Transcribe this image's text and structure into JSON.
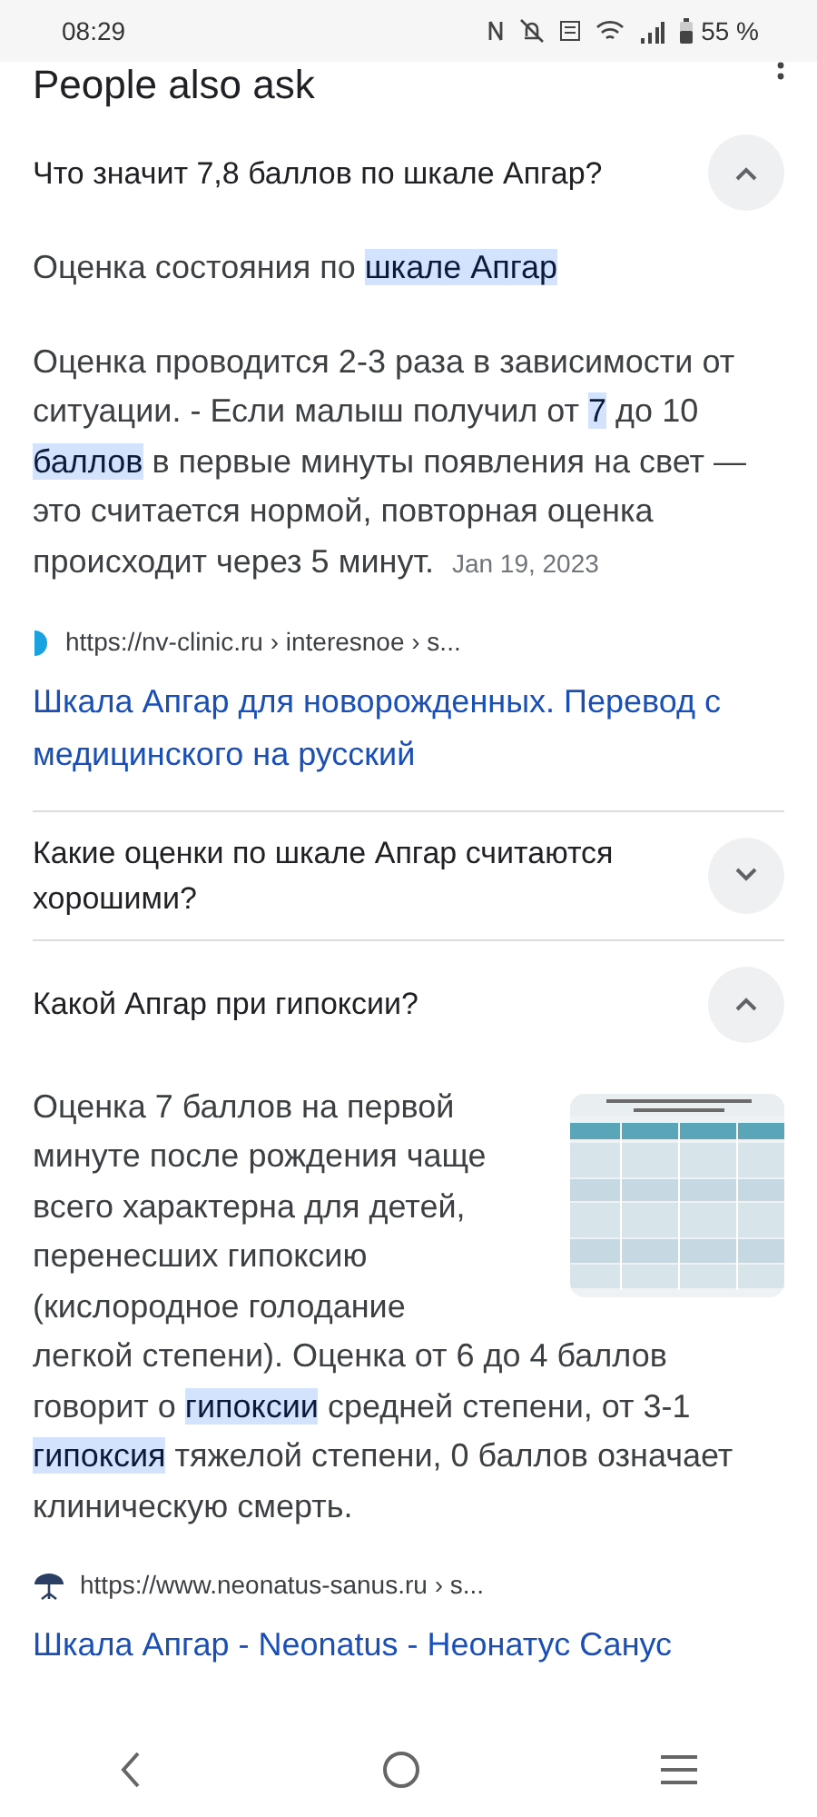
{
  "status_bar": {
    "time": "08:29",
    "battery_text": "55 %"
  },
  "section_title": "People also ask",
  "questions": [
    {
      "question": "Что значит 7,8 баллов по шкале Апгар?",
      "expanded": true,
      "answer": {
        "heading": "Оценка состояния по **шкале Апгар**",
        "text": "Оценка проводится 2-3 раза в зависимости от ситуации. - Если малыш получил от **7** до 10 **баллов** в первые минуты появления на свет — это считается нормой, повторная оценка происходит через 5 минут.",
        "date": "Jan 19, 2023",
        "source": {
          "kind": "half-circle",
          "url": "https://nv-clinic.ru › interesnoe › s...",
          "title": "Шкала Апгар для новорожденных. Перевод с медицинского на русский"
        }
      }
    },
    {
      "question": "Какие оценки по шкале Апгар считаются хорошими?",
      "expanded": false
    },
    {
      "question": "Какой Апгар при гипоксии?",
      "expanded": true,
      "answer": {
        "text": "Оценка 7 баллов на первой минуте после рождения чаще всего характерна для детей, перенесших гипоксию (кислородное голодание легкой степени). Оценка от 6 до 4 баллов говорит о **гипоксии** средней степени, от 3-1 **гипоксия** тяжелой степени, 0 баллов означает клиническую смерть.",
        "source": {
          "kind": "tree",
          "url": "https://www.neonatus-sanus.ru › s...",
          "title": "Шкала Апгар - Neonatus - Неонатус Санус"
        }
      }
    }
  ]
}
